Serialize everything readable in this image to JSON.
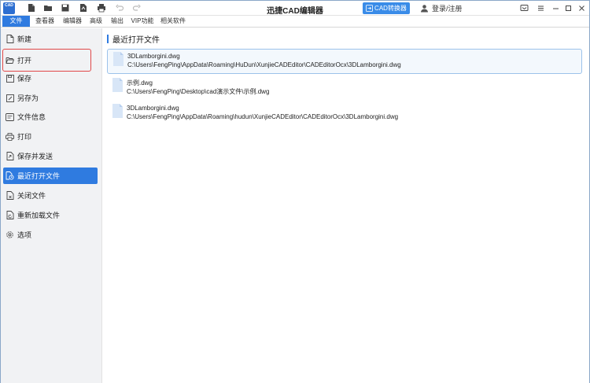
{
  "titlebar": {
    "app_logo_text": "CAD",
    "title": "迅捷CAD编辑器",
    "converter_label": "CAD转换器",
    "login_label": "登录/注册"
  },
  "menu": [
    {
      "label": "文件",
      "active": true
    },
    {
      "label": "查看器",
      "active": false
    },
    {
      "label": "编辑器",
      "active": false
    },
    {
      "label": "高级",
      "active": false
    },
    {
      "label": "输出",
      "active": false
    },
    {
      "label": "VIP功能",
      "active": false
    },
    {
      "label": "相关软件",
      "active": false
    }
  ],
  "sidebar": {
    "items": [
      {
        "label": "新建",
        "icon": "new-file-icon"
      },
      {
        "label": "打开",
        "icon": "open-folder-icon",
        "highlighted": true
      },
      {
        "label": "保存",
        "icon": "save-icon"
      },
      {
        "label": "另存为",
        "icon": "save-as-icon"
      },
      {
        "label": "文件信息",
        "icon": "file-info-icon"
      },
      {
        "label": "打印",
        "icon": "print-icon"
      },
      {
        "label": "保存并发送",
        "icon": "save-send-icon"
      },
      {
        "label": "最近打开文件",
        "icon": "recent-files-icon",
        "active": true
      },
      {
        "label": "关闭文件",
        "icon": "close-file-icon"
      },
      {
        "label": "重新加载文件",
        "icon": "reload-file-icon"
      },
      {
        "label": "选项",
        "icon": "options-gear-icon"
      }
    ]
  },
  "main": {
    "section_title": "最近打开文件",
    "recent_files": [
      {
        "name": "3DLamborgini.dwg",
        "path": "C:\\Users\\FengPing\\AppData\\Roaming\\HuDun\\XunjieCADEditor\\CADEditorOcx\\3DLamborgini.dwg",
        "selected": true
      },
      {
        "name": "示例.dwg",
        "path": "C:\\Users\\FengPing\\Desktop\\cad演示文件\\示例.dwg",
        "selected": false
      },
      {
        "name": "3DLamborgini.dwg",
        "path": "C:\\Users\\FengPing\\AppData\\Roaming\\hudun\\XunjieCADEditor\\CADEditorOcx\\3DLamborgini.dwg",
        "selected": false
      }
    ]
  },
  "colors": {
    "accent": "#2f7be0",
    "highlight_border": "#e04848",
    "sidebar_bg": "#f1f2f4"
  }
}
